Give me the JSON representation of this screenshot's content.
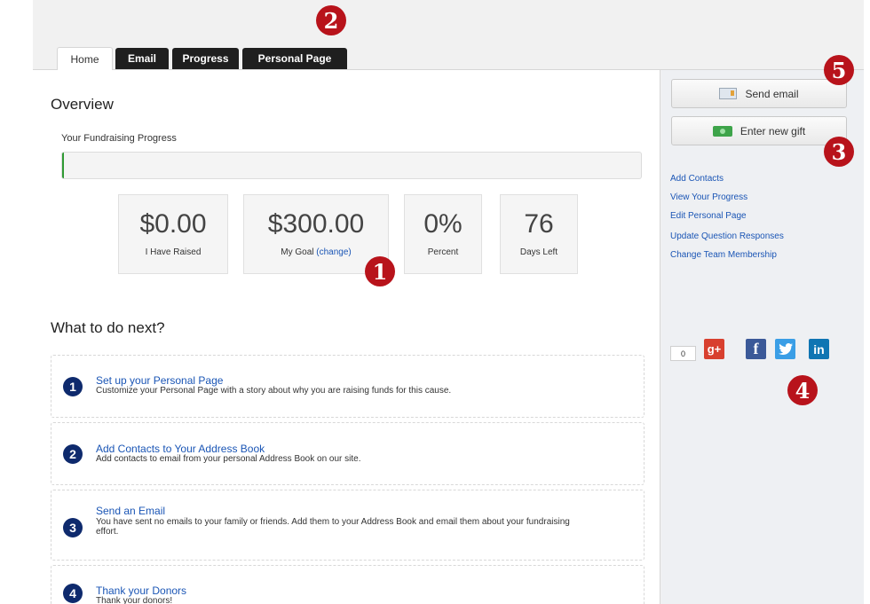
{
  "tabs": [
    {
      "label": "Home",
      "active": true
    },
    {
      "label": "Email"
    },
    {
      "label": "Progress"
    },
    {
      "label": "Personal Page"
    }
  ],
  "overview": {
    "heading": "Overview",
    "progress_label": "Your Fundraising Progress",
    "progress_fraction": 0.0,
    "stats": {
      "raised": {
        "value": "$0.00",
        "caption": "I Have Raised"
      },
      "goal": {
        "value": "$300.00",
        "caption": "My Goal",
        "change_link": "(change)"
      },
      "percent": {
        "value": "0%",
        "caption": "Percent"
      },
      "days": {
        "value": "76",
        "caption": "Days Left"
      }
    }
  },
  "next": {
    "heading": "What to do next?",
    "steps": [
      {
        "num": "1",
        "title": "Set up your Personal Page",
        "desc": "Customize your Personal Page with a story about why you are raising funds for this cause."
      },
      {
        "num": "2",
        "title": "Add Contacts to Your Address Book",
        "desc": "Add contacts to email from your personal Address Book on our site."
      },
      {
        "num": "3",
        "title": "Send an Email",
        "desc": "You have sent no emails to your family or friends. Add them to your Address Book and email them about your fundraising effort."
      },
      {
        "num": "4",
        "title": "Thank your Donors",
        "desc": "Thank your donors!"
      }
    ]
  },
  "sidebar": {
    "send_email": "Send email",
    "enter_gift": "Enter new gift",
    "links": [
      "Add Contacts",
      "View Your Progress",
      "Edit Personal Page",
      "Update Question Responses",
      "Change Team Membership"
    ],
    "share_count": "0",
    "social": {
      "googleplus": "g+",
      "facebook": "f",
      "twitter": "t",
      "linkedin": "in"
    }
  },
  "callouts": [
    "1",
    "2",
    "3",
    "4",
    "5"
  ],
  "colors": {
    "callout": "#b8131b",
    "link": "#1a55b5",
    "progress": "#2f9a33",
    "step_number": "#0e2a6d"
  }
}
